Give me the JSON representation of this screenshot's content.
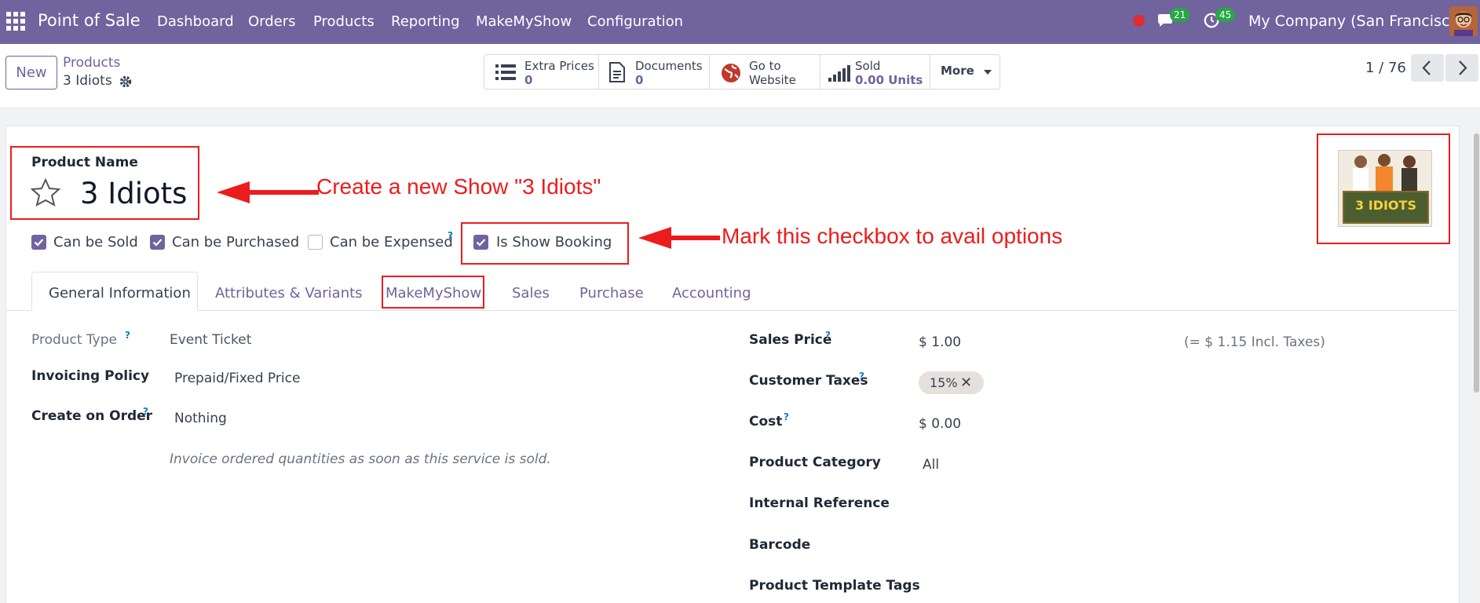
{
  "navbar": {
    "brand": "Point of Sale",
    "menu": [
      "Dashboard",
      "Orders",
      "Products",
      "Reporting",
      "MakeMyShow",
      "Configuration"
    ],
    "messages_count": "21",
    "activities_count": "45",
    "company": "My Company (San Francisco)"
  },
  "control_panel": {
    "new_label": "New",
    "breadcrumb_parent": "Products",
    "breadcrumb_current": "3 Idiots",
    "stats": [
      {
        "label": "Extra Prices",
        "value": "0"
      },
      {
        "label": "Documents",
        "value": "0"
      },
      {
        "label_line1": "Go to",
        "label_line2": "Website"
      },
      {
        "label": "Sold",
        "value": "0.00 Units"
      }
    ],
    "more_label": "More",
    "pager": "1 / 76"
  },
  "form": {
    "name_label": "Product Name",
    "name_value": "3 Idiots",
    "image_caption": "3 IDIOTS",
    "checkboxes": [
      {
        "label": "Can be Sold",
        "checked": true
      },
      {
        "label": "Can be Purchased",
        "checked": true
      },
      {
        "label": "Can be Expensed",
        "checked": false
      },
      {
        "label": "Is Show Booking",
        "checked": true
      }
    ],
    "tabs": [
      "General Information",
      "Attributes & Variants",
      "MakeMyShow",
      "Sales",
      "Purchase",
      "Accounting"
    ],
    "left_fields": [
      {
        "label": "Product Type",
        "value": "Event Ticket"
      },
      {
        "label": "Invoicing Policy",
        "value": "Prepaid/Fixed Price"
      },
      {
        "label": "Create on Order",
        "value": "Nothing"
      }
    ],
    "invoice_note": "Invoice ordered quantities as soon as this service is sold.",
    "right_fields": [
      {
        "label": "Sales Price",
        "value": "$ 1.00"
      },
      {
        "label": "Customer Taxes",
        "value": "15%"
      },
      {
        "label": "Cost",
        "value": "$ 0.00"
      },
      {
        "label": "Product Category",
        "value": "All"
      },
      {
        "label": "Internal Reference",
        "value": ""
      },
      {
        "label": "Barcode",
        "value": ""
      },
      {
        "label": "Product Template Tags",
        "value": ""
      }
    ],
    "incl_taxes": "(= $ 1.15 Incl. Taxes)",
    "help_mark": "?"
  },
  "annotations": {
    "create_show": "Create a new Show \"3 Idiots\"",
    "mark_checkbox": "Mark this checkbox to avail options"
  },
  "colors": {
    "brand": "#71639e",
    "annotation": "#ec1c1c",
    "badge": "#28a745"
  }
}
